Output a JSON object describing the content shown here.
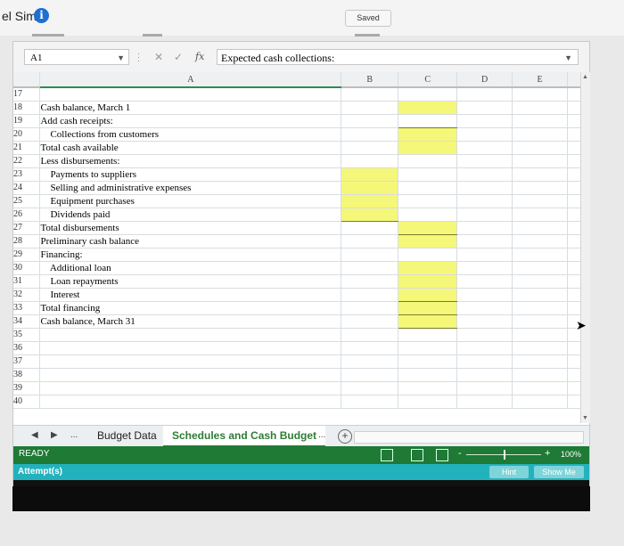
{
  "app": {
    "title": "el Sims",
    "saved_label": "Saved"
  },
  "formula_bar": {
    "name_box": "A1",
    "fx_label": "fx",
    "cancel_symbol": "✕",
    "confirm_symbol": "✓",
    "content": "Expected cash collections:"
  },
  "columns": [
    "A",
    "B",
    "C",
    "D",
    "E"
  ],
  "rows": [
    {
      "num": "17",
      "label": ""
    },
    {
      "num": "18",
      "label": "Cash balance, March 1"
    },
    {
      "num": "19",
      "label": "Add cash receipts:"
    },
    {
      "num": "20",
      "label": "    Collections from customers"
    },
    {
      "num": "21",
      "label": "Total cash available"
    },
    {
      "num": "22",
      "label": "Less disbursements:"
    },
    {
      "num": "23",
      "label": "    Payments to suppliers"
    },
    {
      "num": "24",
      "label": "    Selling and administrative expenses"
    },
    {
      "num": "25",
      "label": "    Equipment purchases"
    },
    {
      "num": "26",
      "label": "    Dividends paid"
    },
    {
      "num": "27",
      "label": "Total disbursements"
    },
    {
      "num": "28",
      "label": "Preliminary cash balance"
    },
    {
      "num": "29",
      "label": "Financing:"
    },
    {
      "num": "30",
      "label": "    Additional loan"
    },
    {
      "num": "31",
      "label": "    Loan repayments"
    },
    {
      "num": "32",
      "label": "    Interest"
    },
    {
      "num": "33",
      "label": "Total financing"
    },
    {
      "num": "34",
      "label": "Cash balance, March 31"
    },
    {
      "num": "35",
      "label": ""
    },
    {
      "num": "36",
      "label": ""
    },
    {
      "num": "37",
      "label": ""
    },
    {
      "num": "38",
      "label": ""
    },
    {
      "num": "39",
      "label": ""
    },
    {
      "num": "40",
      "label": ""
    }
  ],
  "sheet_tabs": [
    {
      "label": "Budget Data",
      "active": false
    },
    {
      "label": "Schedules and Cash Budget",
      "active": true
    }
  ],
  "more_tabs": "...",
  "status": {
    "ready": "READY",
    "zoom": "100%",
    "zoom_minus": "-",
    "zoom_plus": "+"
  },
  "attempt": {
    "label": "Attempt(s)",
    "hint": "Hint",
    "show_me": "Show Me"
  },
  "colors": {
    "accent": "#1e7a34",
    "input_cell": "#f4f778",
    "teal": "#22b2bd"
  }
}
